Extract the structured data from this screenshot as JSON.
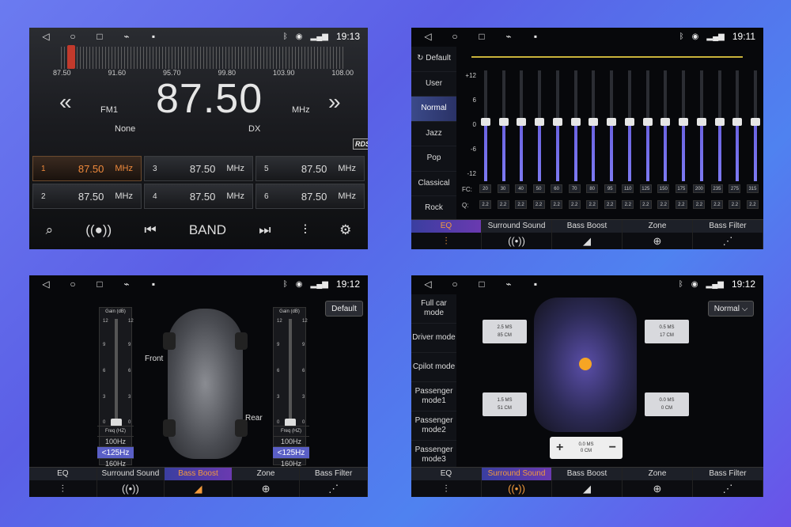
{
  "status": {
    "time1": "19:13",
    "time2": "19:11",
    "time3": "19:12",
    "time4": "19:12"
  },
  "radio": {
    "scale_labels": [
      "87.50",
      "91.60",
      "95.70",
      "99.80",
      "103.90",
      "108.00"
    ],
    "frequency": "87.50",
    "band_label": "FM1",
    "unit": "MHz",
    "ps_text": "None",
    "dx_text": "DX",
    "rds": "RDS",
    "presets": [
      {
        "n": "1",
        "v": "87.50",
        "u": "MHz"
      },
      {
        "n": "3",
        "v": "87.50",
        "u": "MHz"
      },
      {
        "n": "5",
        "v": "87.50",
        "u": "MHz"
      },
      {
        "n": "2",
        "v": "87.50",
        "u": "MHz"
      },
      {
        "n": "4",
        "v": "87.50",
        "u": "MHz"
      },
      {
        "n": "6",
        "v": "87.50",
        "u": "MHz"
      }
    ],
    "band_button": "BAND"
  },
  "eq": {
    "presets": [
      "Default",
      "User",
      "Normal",
      "Jazz",
      "Pop",
      "Classical",
      "Rock"
    ],
    "ticks": [
      "+12",
      "6",
      "0",
      "-6",
      "-12"
    ],
    "fc_label": "FC:",
    "q_label": "Q:",
    "fc": [
      "20",
      "30",
      "40",
      "50",
      "60",
      "70",
      "80",
      "95",
      "110",
      "125",
      "150",
      "175",
      "200",
      "235",
      "275",
      "315"
    ],
    "q": [
      "2.2",
      "2.2",
      "2.2",
      "2.2",
      "2.2",
      "2.2",
      "2.2",
      "2.2",
      "2.2",
      "2.2",
      "2.2",
      "2.2",
      "2.2",
      "2.2",
      "2.2",
      "2.2"
    ]
  },
  "tabs": [
    "EQ",
    "Surround Sound",
    "Bass Boost",
    "Zone",
    "Bass Filter"
  ],
  "bass": {
    "gain_header": "Gain  (dB)",
    "gain_nums": [
      "12",
      "9",
      "6",
      "3",
      "0"
    ],
    "freq_header": "Freq  (HZ)",
    "freq_options": [
      "100Hz",
      "<125Hz",
      "160Hz"
    ],
    "front": "Front",
    "rear": "Rear",
    "default_btn": "Default"
  },
  "surround": {
    "modes": [
      "Full car mode",
      "Driver mode",
      "Cpilot mode",
      "Passenger mode1",
      "Passenger mode2",
      "Passenger mode3"
    ],
    "selector": "Normal",
    "boxes": [
      {
        "a": "2.5 MS",
        "b": "85 CM"
      },
      {
        "a": "0.5 MS",
        "b": "17 CM"
      },
      {
        "a": "1.5 MS",
        "b": "51 CM"
      },
      {
        "a": "0.0 MS",
        "b": "0 CM"
      }
    ],
    "stepper": {
      "a": "0.0 MS",
      "b": "0 CM",
      "plus": "+",
      "minus": "−"
    }
  }
}
